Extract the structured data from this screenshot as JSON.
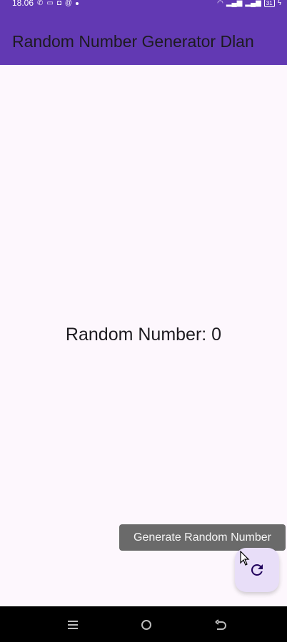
{
  "status_bar": {
    "time": "18.06",
    "battery": "31"
  },
  "app_bar": {
    "title": "Random Number Generator Dlan"
  },
  "main": {
    "random_number_text": "Random Number: 0"
  },
  "fab": {
    "icon": "refresh-icon",
    "tooltip": "Generate Random Number"
  },
  "colors": {
    "primary": "#6239b3",
    "background": "#fdf7fd",
    "fab": "#e8def8",
    "tooltip": "#6a6a6a"
  }
}
